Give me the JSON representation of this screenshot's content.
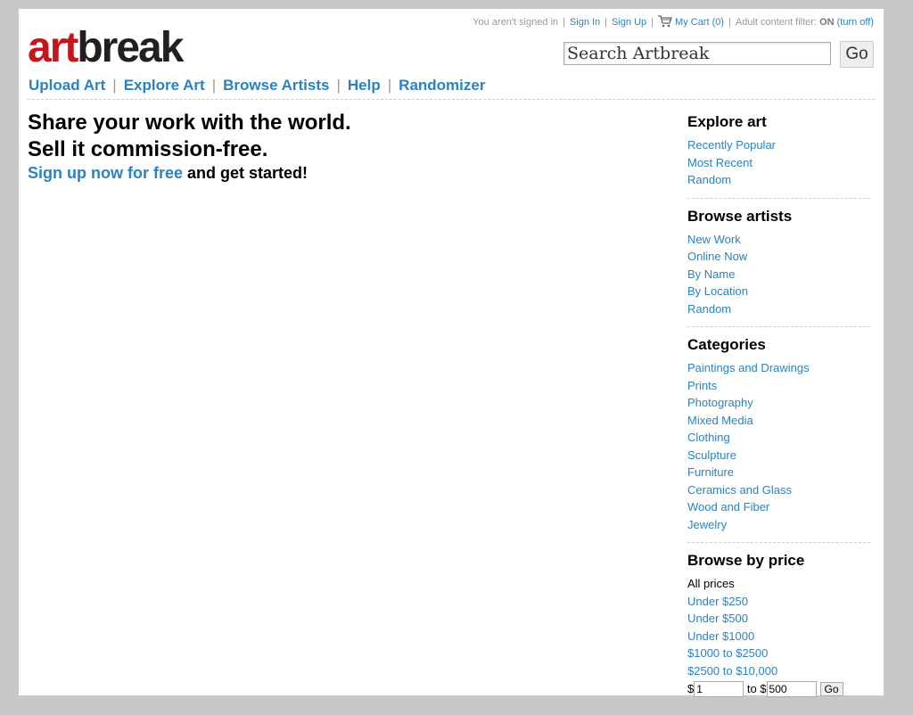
{
  "topbar": {
    "signed_in_text": "You aren't signed in",
    "sign_in": "Sign In",
    "sign_up": "Sign Up",
    "cart": "My Cart (0)",
    "adult_filter_label": "Adult content filter:",
    "adult_filter_state": "ON",
    "turn_off": "(turn off)",
    "separator": "|"
  },
  "logo": {
    "part1": "art",
    "part2": "break",
    "colors": {
      "art": "#c4161c",
      "break": "#231f20"
    }
  },
  "search": {
    "value": "Search Artbreak",
    "go_label": "Go"
  },
  "nav": {
    "items": [
      "Upload Art",
      "Explore Art",
      "Browse Artists",
      "Help",
      "Randomizer"
    ],
    "separator": "|"
  },
  "hero": {
    "line1": "Share your work with the world.",
    "line2": "Sell it commission-free.",
    "cta_link": "Sign up now for free",
    "cta_rest": " and get started!"
  },
  "sidebar": {
    "explore": {
      "title": "Explore art",
      "items": [
        "Recently Popular",
        "Most Recent",
        "Random"
      ]
    },
    "browse_artists": {
      "title": "Browse artists",
      "items": [
        "New Work",
        "Online Now",
        "By Name",
        "By Location",
        "Random"
      ]
    },
    "categories": {
      "title": "Categories",
      "items": [
        "Paintings and Drawings",
        "Prints",
        "Photography",
        "Mixed Media",
        "Clothing",
        "Sculpture",
        "Furniture",
        "Ceramics and Glass",
        "Wood and Fiber",
        "Jewelry"
      ]
    },
    "price": {
      "title": "Browse by price",
      "current": "All prices",
      "items": [
        "Under $250",
        "Under $500",
        "Under $1000",
        "$1000 to $2500",
        "$2500 to $10,000"
      ],
      "range": {
        "from_prefix": "$",
        "from_value": "1",
        "to_label": "to $",
        "to_value": "500",
        "go_label": "Go"
      }
    }
  },
  "colors": {
    "link": "#2b82c2",
    "background": "#c8c8c8"
  }
}
